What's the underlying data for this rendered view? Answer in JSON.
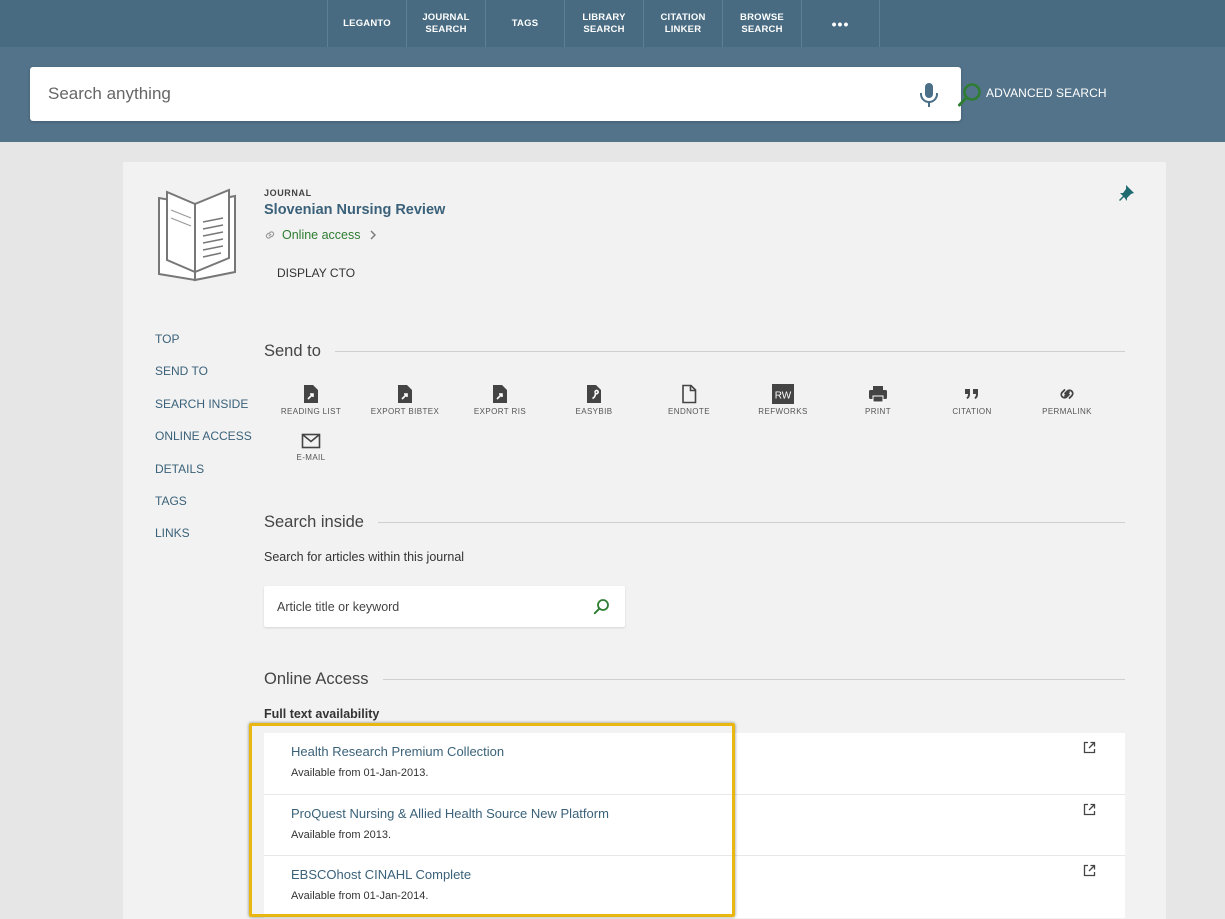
{
  "nav": {
    "items": [
      {
        "label": "LEGANTO"
      },
      {
        "label": "JOURNAL\nSEARCH"
      },
      {
        "label": "TAGS"
      },
      {
        "label": "LIBRARY\nSEARCH"
      },
      {
        "label": "CITATION\nLINKER"
      },
      {
        "label": "BROWSE\nSEARCH"
      },
      {
        "label": "•••"
      }
    ]
  },
  "search": {
    "placeholder": "Search anything",
    "advanced_label": "ADVANCED SEARCH"
  },
  "record": {
    "type": "JOURNAL",
    "title": "Slovenian Nursing Review",
    "online_access": "Online access",
    "display_cto": "DISPLAY CTO"
  },
  "sidenav": {
    "items": [
      "TOP",
      "SEND TO",
      "SEARCH INSIDE",
      "ONLINE ACCESS",
      "DETAILS",
      "TAGS",
      "LINKS"
    ]
  },
  "send_to": {
    "title": "Send to",
    "actions": [
      {
        "label": "READING LIST",
        "icon": "reading-list-icon"
      },
      {
        "label": "EXPORT BIBTEX",
        "icon": "export-bibtex-icon"
      },
      {
        "label": "EXPORT RIS",
        "icon": "export-ris-icon"
      },
      {
        "label": "EASYBIB",
        "icon": "easybib-icon"
      },
      {
        "label": "ENDNOTE",
        "icon": "endnote-icon"
      },
      {
        "label": "REFWORKS",
        "icon": "refworks-icon",
        "badge": "RW"
      },
      {
        "label": "PRINT",
        "icon": "print-icon"
      },
      {
        "label": "CITATION",
        "icon": "citation-icon"
      },
      {
        "label": "PERMALINK",
        "icon": "permalink-icon"
      },
      {
        "label": "E-MAIL",
        "icon": "email-icon"
      }
    ]
  },
  "search_inside": {
    "title": "Search inside",
    "description": "Search for articles within this journal",
    "placeholder": "Article title or keyword"
  },
  "online_access_section": {
    "title": "Online Access",
    "availability_label": "Full text availability",
    "sources": [
      {
        "name": "Health Research Premium Collection",
        "available": "Available from 01-Jan-2013."
      },
      {
        "name": "ProQuest Nursing & Allied Health Source New Platform",
        "available": "Available from 2013."
      },
      {
        "name": "EBSCOhost CINAHL Complete",
        "available": "Available from 01-Jan-2014."
      }
    ]
  },
  "colors": {
    "nav_bg": "#486b82",
    "search_band_bg": "#53738a",
    "link": "#3a6179",
    "green": "#2e7d32",
    "highlight": "#e8b712"
  }
}
